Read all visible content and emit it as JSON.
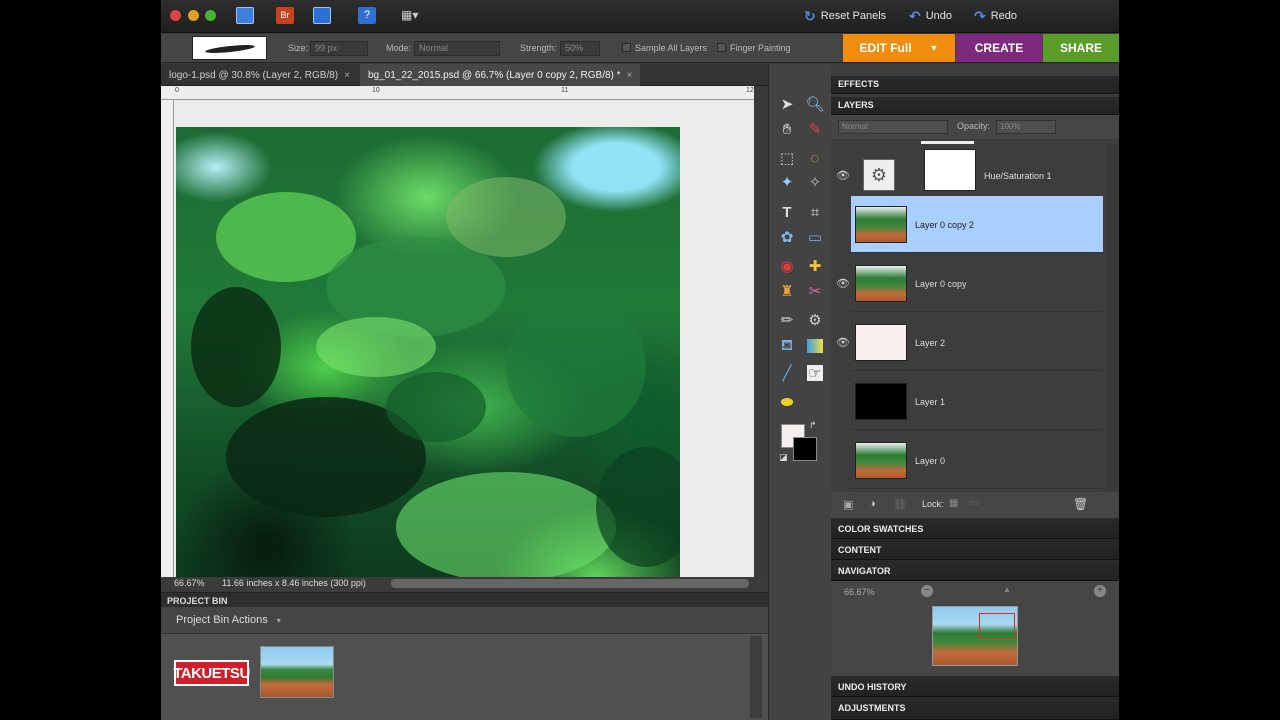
{
  "titlebar": {
    "actions": {
      "reset_panels": "Reset Panels",
      "undo": "Undo",
      "redo": "Redo"
    },
    "icons": [
      "organizer-icon",
      "bridge-icon",
      "save-icon",
      "help-icon",
      "layout-icon"
    ]
  },
  "options": {
    "size_label": "Size:",
    "size_value": "99 px",
    "mode_label": "Mode:",
    "mode_value": "Normal",
    "strength_label": "Strength:",
    "strength_value": "50%",
    "sample_all_layers": "Sample All Layers",
    "finger_painting": "Finger Painting"
  },
  "modes": {
    "edit": "EDIT Full",
    "create": "CREATE",
    "share": "SHARE"
  },
  "colors": {
    "edit": "#f08c0e",
    "create": "#7d2a7e",
    "share": "#5b9b2a",
    "selected_layer": "#a9cfff"
  },
  "tabs": [
    {
      "label": "logo-1.psd @ 30.8% (Layer 2, RGB/8)",
      "close": "×"
    },
    {
      "label": "bg_01_22_2015.psd @ 66.7% (Layer 0 copy 2, RGB/8) *",
      "close": "×"
    }
  ],
  "ruler_marks": [
    "0",
    "10",
    "11",
    "12"
  ],
  "status": {
    "zoom": "66.67%",
    "dimensions": "11.66 inches x 8.46 inches (300 ppi)"
  },
  "project_bin": {
    "title": "PROJECT BIN",
    "actions": "Project Bin Actions",
    "items": [
      {
        "logo_text": "TAKUETSU"
      },
      {
        "logo_text": ""
      }
    ]
  },
  "panels": {
    "effects": "EFFECTS",
    "layers": "LAYERS",
    "blend_mode": "Normal",
    "opacity_label": "Opacity:",
    "opacity_value": "100%",
    "lock_label": "Lock:",
    "color_swatches": "COLOR SWATCHES",
    "content": "CONTENT",
    "navigator": "NAVIGATOR",
    "navigator_zoom": "66.67%",
    "undo_history": "UNDO HISTORY",
    "adjustments": "ADJUSTMENTS"
  },
  "layers": [
    {
      "name": "Hue/Saturation 1",
      "visible": true,
      "selected": false,
      "kind": "adjustment"
    },
    {
      "name": "Layer 0 copy 2",
      "visible": true,
      "selected": true,
      "kind": "scene"
    },
    {
      "name": "Layer 0 copy",
      "visible": true,
      "selected": false,
      "kind": "scene"
    },
    {
      "name": "Layer 2",
      "visible": true,
      "selected": false,
      "kind": "white"
    },
    {
      "name": "Layer 1",
      "visible": false,
      "selected": false,
      "kind": "black"
    },
    {
      "name": "Layer 0",
      "visible": false,
      "selected": false,
      "kind": "scene"
    }
  ]
}
